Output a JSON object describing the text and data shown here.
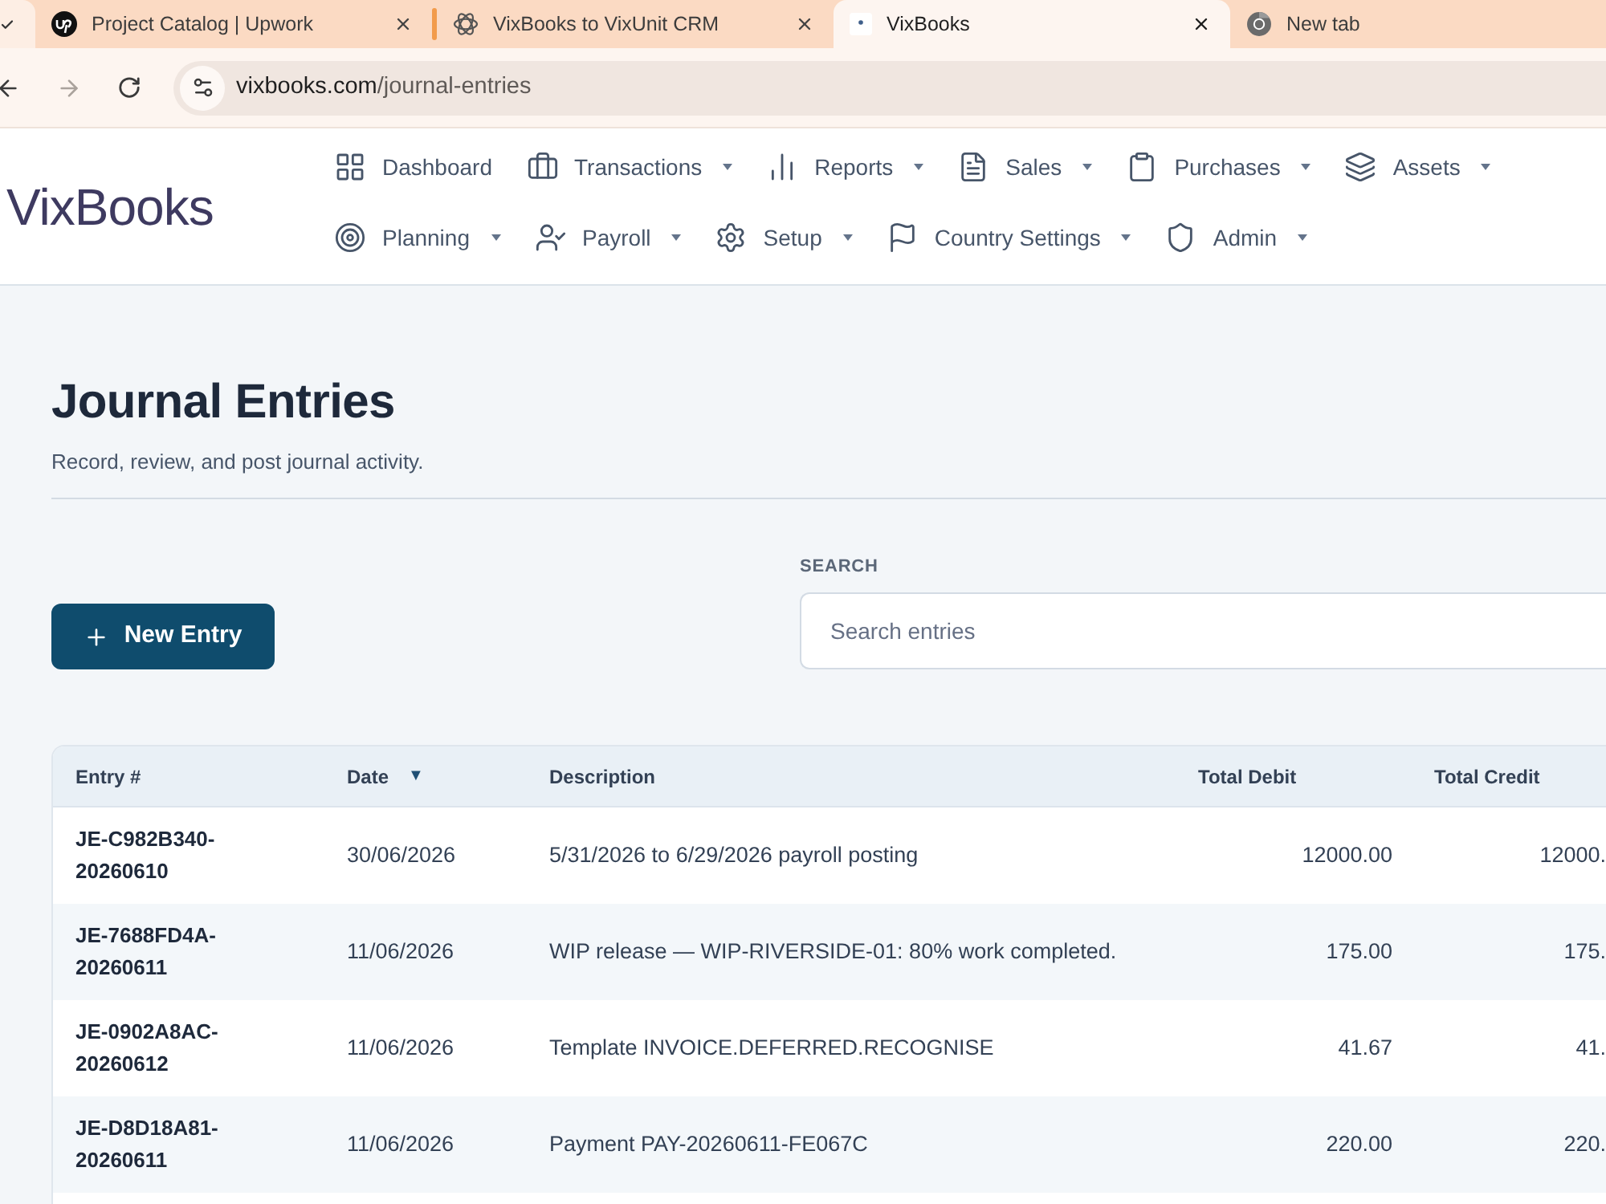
{
  "browser": {
    "tabs": [
      {
        "title": "Project Catalog | Upwork",
        "selected": false,
        "show_close": true
      },
      {
        "title": "VixBooks to VixUnit CRM",
        "selected": false,
        "show_close": true
      },
      {
        "title": "VixBooks",
        "selected": true,
        "show_close": true
      },
      {
        "title": "New tab",
        "selected": false,
        "show_close": false
      }
    ],
    "back_enabled": true,
    "forward_enabled": false,
    "url": "vixbooks.com/journal-entries"
  },
  "app": {
    "logo": "VixBooks",
    "nav": [
      [
        {
          "label": "Dashboard",
          "dropdown": false
        },
        {
          "label": "Transactions",
          "dropdown": true
        },
        {
          "label": "Reports",
          "dropdown": true
        },
        {
          "label": "Sales",
          "dropdown": true
        },
        {
          "label": "Purchases",
          "dropdown": true
        },
        {
          "label": "Assets",
          "dropdown": true
        }
      ],
      [
        {
          "label": "Planning",
          "dropdown": true
        },
        {
          "label": "Payroll",
          "dropdown": true
        },
        {
          "label": "Setup",
          "dropdown": true
        },
        {
          "label": "Country Settings",
          "dropdown": true
        },
        {
          "label": "Admin",
          "dropdown": true
        }
      ]
    ]
  },
  "page": {
    "title": "Journal Entries",
    "subtitle": "Record, review, and post journal activity.",
    "new_button": "New Entry",
    "search": {
      "label": "SEARCH",
      "placeholder": "Search entries"
    },
    "table": {
      "columns": [
        {
          "label": "Entry #"
        },
        {
          "label": "Date",
          "sort_mark": "▼"
        },
        {
          "label": "Description"
        },
        {
          "label": "Total Debit"
        },
        {
          "label": "Total Credit"
        }
      ],
      "rows": [
        {
          "entry": "JE-C982B340-20260610",
          "date": "30/06/2026",
          "description": "5/31/2026 to 6/29/2026 payroll posting",
          "total_debit": "12000.00",
          "total_credit": "12000."
        },
        {
          "entry": "JE-7688FD4A-20260611",
          "date": "11/06/2026",
          "description": "WIP release — WIP-RIVERSIDE-01: 80% work completed.",
          "total_debit": "175.00",
          "total_credit": "175."
        },
        {
          "entry": "JE-0902A8AC-20260612",
          "date": "11/06/2026",
          "description": "Template INVOICE.DEFERRED.RECOGNISE",
          "total_debit": "41.67",
          "total_credit": "41."
        },
        {
          "entry": "JE-D8D18A81-20260611",
          "date": "11/06/2026",
          "description": "Payment PAY-20260611-FE067C",
          "total_debit": "220.00",
          "total_credit": "220."
        }
      ]
    }
  }
}
